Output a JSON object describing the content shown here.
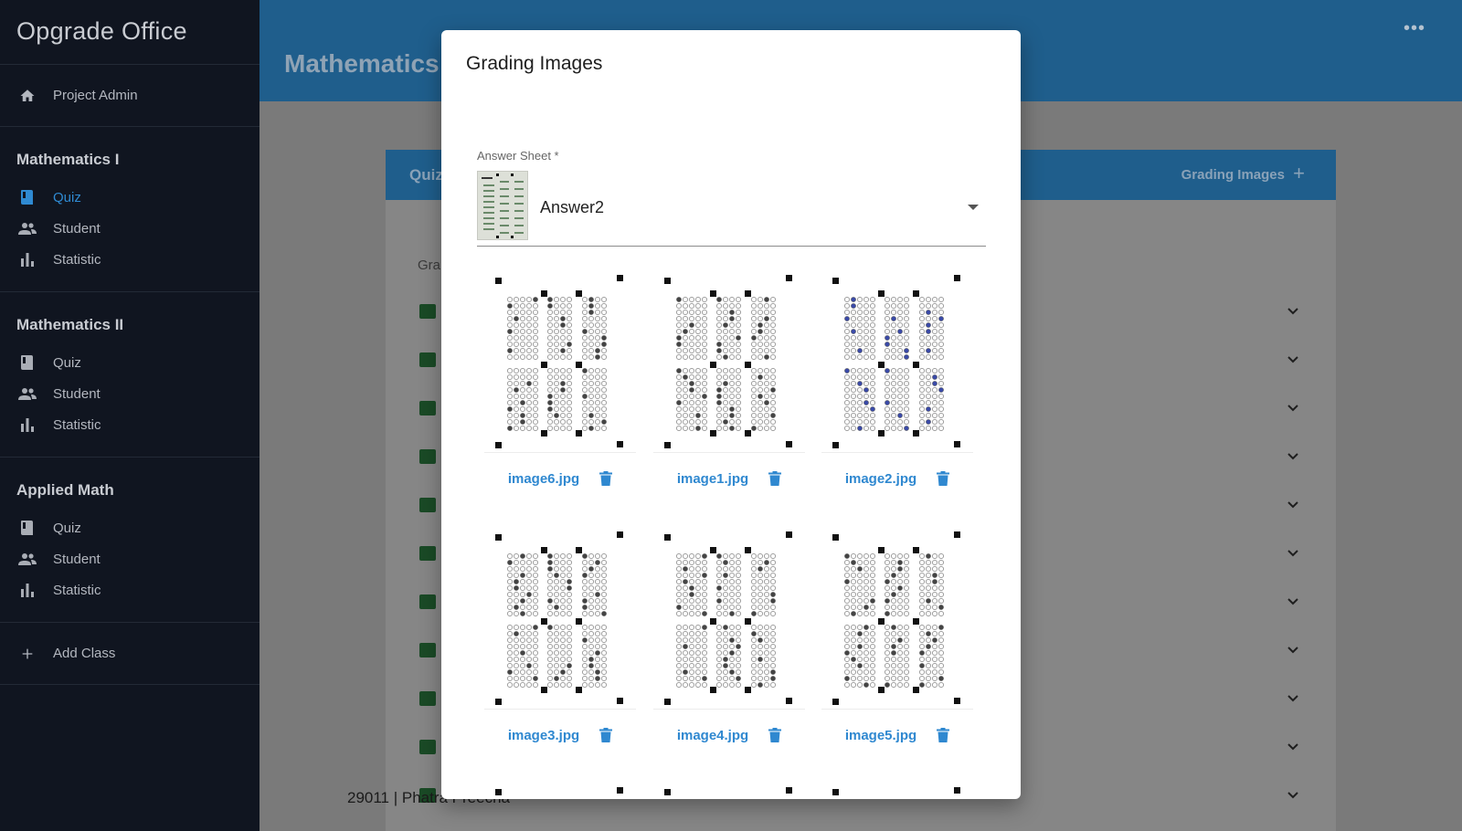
{
  "app": {
    "title": "Opgrade Office"
  },
  "sidebar": {
    "top_item": "Project Admin",
    "sections": [
      {
        "title": "Mathematics I",
        "items": [
          "Quiz",
          "Student",
          "Statistic"
        ],
        "active": 0
      },
      {
        "title": "Mathematics II",
        "items": [
          "Quiz",
          "Student",
          "Statistic"
        ],
        "active": -1
      },
      {
        "title": "Applied Math",
        "items": [
          "Quiz",
          "Student",
          "Statistic"
        ],
        "active": -1
      }
    ],
    "add_class": "Add Class"
  },
  "main": {
    "page_title": "Mathematics",
    "card_tab": "Quiz",
    "card_action": "Grading Images",
    "list_header": "Gra",
    "last_row_text": "29011 | Phatra Preecha"
  },
  "modal": {
    "title": "Grading Images",
    "answer_sheet_label": "Answer Sheet *",
    "answer_sheet_value": "Answer2",
    "images": [
      "image6.jpg",
      "image1.jpg",
      "image2.jpg",
      "image3.jpg",
      "image4.jpg",
      "image5.jpg"
    ]
  },
  "colors": {
    "accent": "#2f88d0",
    "sidebar_bg": "#101520",
    "topbar": "#1f5e8c"
  }
}
